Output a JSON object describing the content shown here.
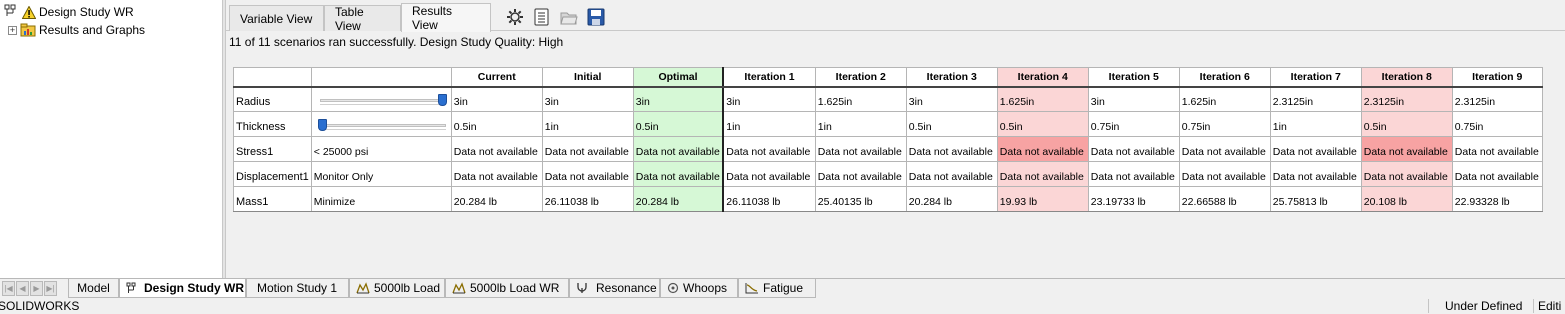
{
  "tree": {
    "root_label": "Design Study WR",
    "child_label": "Results and Graphs"
  },
  "view_tabs": [
    "Variable View",
    "Table View",
    "Results View"
  ],
  "toolbar_icons": [
    "gear-icon",
    "list-settings-icon",
    "open-folder-icon",
    "save-icon"
  ],
  "status_message": "11 of 11 scenarios ran successfully. Design Study Quality: High",
  "table": {
    "columns": [
      "Current",
      "Initial",
      "Optimal",
      "Iteration 1",
      "Iteration 2",
      "Iteration 3",
      "Iteration 4",
      "Iteration 5",
      "Iteration 6",
      "Iteration 7",
      "Iteration 8",
      "Iteration 9"
    ],
    "rows": [
      {
        "label": "Radius",
        "setting": "",
        "slider_position": 1.0,
        "values": [
          "3in",
          "3in",
          "3in",
          "3in",
          "1.625in",
          "3in",
          "1.625in",
          "3in",
          "1.625in",
          "2.3125in",
          "2.3125in",
          "2.3125in"
        ]
      },
      {
        "label": "Thickness",
        "setting": "",
        "slider_position": 0.0,
        "values": [
          "0.5in",
          "1in",
          "0.5in",
          "1in",
          "1in",
          "0.5in",
          "0.5in",
          "0.75in",
          "0.75in",
          "1in",
          "0.5in",
          "0.75in"
        ]
      },
      {
        "label": "Stress1",
        "setting": "< 25000 psi",
        "values": [
          "Data not available",
          "Data not available",
          "Data not available",
          "Data not available",
          "Data not available",
          "Data not available",
          "Data not available",
          "Data not available",
          "Data not available",
          "Data not available",
          "Data not available",
          "Data not available"
        ]
      },
      {
        "label": "Displacement1",
        "setting": "Monitor Only",
        "values": [
          "Data not available",
          "Data not available",
          "Data not available",
          "Data not available",
          "Data not available",
          "Data not available",
          "Data not available",
          "Data not available",
          "Data not available",
          "Data not available",
          "Data not available",
          "Data not available"
        ]
      },
      {
        "label": "Mass1",
        "setting": "Minimize",
        "values": [
          "20.284 lb",
          "26.11038 lb",
          "20.284 lb",
          "26.11038 lb",
          "25.40135 lb",
          "20.284 lb",
          "19.93 lb",
          "23.19733 lb",
          "22.66588 lb",
          "25.75813 lb",
          "20.108 lb",
          "22.93328 lb"
        ]
      }
    ],
    "colors": {
      "optimal": "#d6f8d6",
      "violation": "#fbd6d6",
      "violation_strong": "#f7a3a3"
    }
  },
  "bottom_tabs": [
    {
      "label": "Model",
      "icon": ""
    },
    {
      "label": "Design Study WR",
      "icon": "design-study-icon",
      "active": true
    },
    {
      "label": "Motion Study 1",
      "icon": ""
    },
    {
      "label": "5000lb Load",
      "icon": "static-study-icon"
    },
    {
      "label": "5000lb Load WR",
      "icon": "static-study-icon"
    },
    {
      "label": "Resonance",
      "icon": "frequency-study-icon"
    },
    {
      "label": "Whoops",
      "icon": "drop-test-icon"
    },
    {
      "label": "Fatigue",
      "icon": "fatigue-study-icon"
    }
  ],
  "statusbar": {
    "app_name": "SOLIDWORKS",
    "state": "Under Defined",
    "mode": "Editi"
  }
}
